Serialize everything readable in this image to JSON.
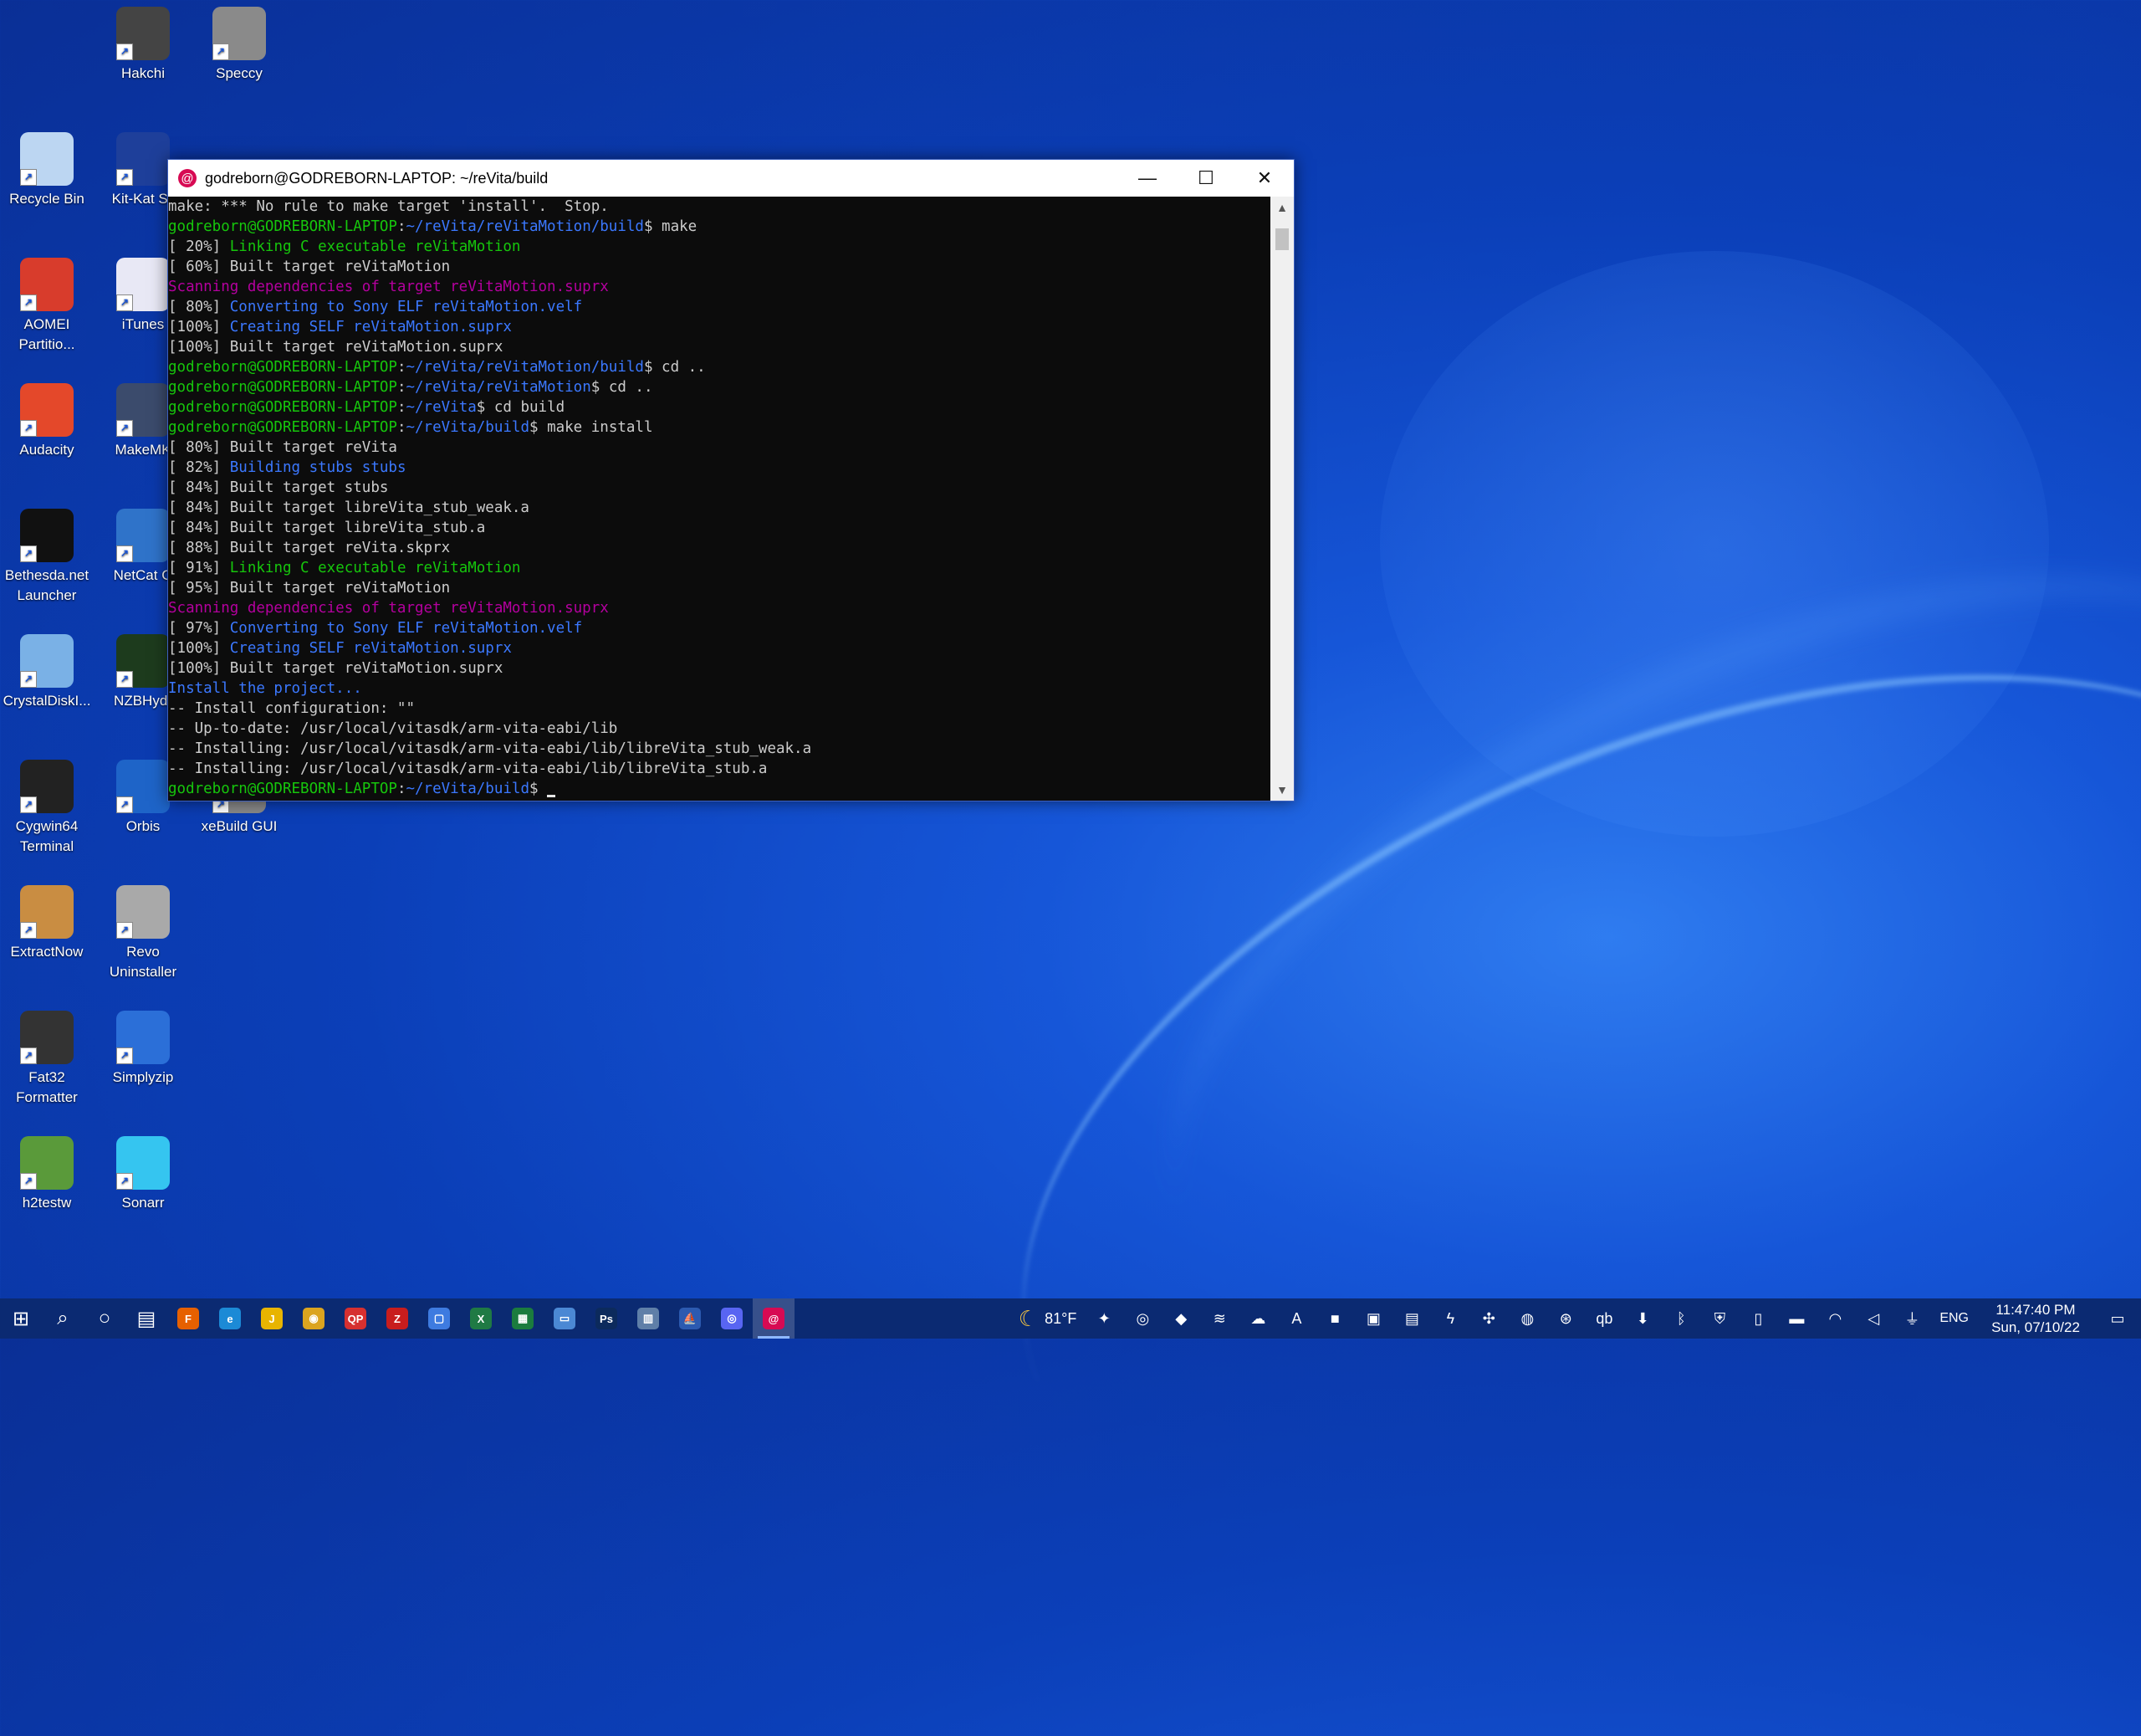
{
  "desktop": {
    "icons": [
      {
        "label": "Hakchi",
        "icon": "hakchi-icon",
        "color": "#444"
      },
      {
        "label": "Speccy",
        "icon": "speccy-icon",
        "color": "#8a8a8a"
      },
      {
        "label": "Recycle Bin",
        "icon": "recycle-bin-icon",
        "color": "#bcd6f2"
      },
      {
        "label": "Kit-Kat Sli",
        "icon": "kit-kat-slim-icon",
        "color": "#1e3f9a"
      },
      {
        "label": "AOMEI Partitio...",
        "icon": "aomei-icon",
        "color": "#d83c2c"
      },
      {
        "label": "iTunes",
        "icon": "itunes-icon",
        "color": "#e8e8f5"
      },
      {
        "label": "Audacity",
        "icon": "audacity-icon",
        "color": "#e4482a"
      },
      {
        "label": "MakeMK",
        "icon": "makemkv-icon",
        "color": "#3b4b6c"
      },
      {
        "label": "Bethesda.net Launcher",
        "icon": "bethesda-icon",
        "color": "#111"
      },
      {
        "label": "NetCat G",
        "icon": "netcat-icon",
        "color": "#2f73c9"
      },
      {
        "label": "CrystalDiskI...",
        "icon": "crystaldisk-icon",
        "color": "#7ab1e6"
      },
      {
        "label": "NZBHydr",
        "icon": "nzbhydra-icon",
        "color": "#1d3b1d"
      },
      {
        "label": "Cygwin64 Terminal",
        "icon": "cygwin-icon",
        "color": "#222"
      },
      {
        "label": "Orbis",
        "icon": "orbis-icon",
        "color": "#1e64c8"
      },
      {
        "label": "xeBuild GUI",
        "icon": "xebuild-icon",
        "color": "#888"
      },
      {
        "label": "ExtractNow",
        "icon": "extractnow-icon",
        "color": "#c98d42"
      },
      {
        "label": "Revo Uninstaller",
        "icon": "revo-icon",
        "color": "#a9a9a9"
      },
      {
        "label": "Fat32 Formatter",
        "icon": "fat32-icon",
        "color": "#333"
      },
      {
        "label": "Simplyzip",
        "icon": "simplyzip-icon",
        "color": "#2b6fd8"
      },
      {
        "label": "h2testw",
        "icon": "h2testw-icon",
        "color": "#5a9a3a"
      },
      {
        "label": "Sonarr",
        "icon": "sonarr-icon",
        "color": "#35c5f0"
      }
    ]
  },
  "terminal": {
    "title": "godreborn@GODREBORN-LAPTOP: ~/reVita/build",
    "minimize": "—",
    "maximize": "☐",
    "close": "✕",
    "lines": [
      [
        {
          "t": "make: *** No rule to make target 'install'.  Stop.",
          "c": ""
        }
      ],
      [
        {
          "t": "godreborn@GODREBORN-LAPTOP",
          "c": "c-green"
        },
        {
          "t": ":",
          "c": ""
        },
        {
          "t": "~/reVita/reVitaMotion/build",
          "c": "c-blue"
        },
        {
          "t": "$ make",
          "c": ""
        }
      ],
      [
        {
          "t": "[ 20%] ",
          "c": ""
        },
        {
          "t": "Linking C executable reVitaMotion",
          "c": "c-green"
        }
      ],
      [
        {
          "t": "[ 60%] Built target reVitaMotion",
          "c": ""
        }
      ],
      [
        {
          "t": "Scanning dependencies of target reVitaMotion.suprx",
          "c": "c-magenta"
        }
      ],
      [
        {
          "t": "[ 80%] ",
          "c": ""
        },
        {
          "t": "Converting to Sony ELF reVitaMotion.velf",
          "c": "c-blue"
        }
      ],
      [
        {
          "t": "[100%] ",
          "c": ""
        },
        {
          "t": "Creating SELF reVitaMotion.suprx",
          "c": "c-blue"
        }
      ],
      [
        {
          "t": "[100%] Built target reVitaMotion.suprx",
          "c": ""
        }
      ],
      [
        {
          "t": "godreborn@GODREBORN-LAPTOP",
          "c": "c-green"
        },
        {
          "t": ":",
          "c": ""
        },
        {
          "t": "~/reVita/reVitaMotion/build",
          "c": "c-blue"
        },
        {
          "t": "$ cd ..",
          "c": ""
        }
      ],
      [
        {
          "t": "godreborn@GODREBORN-LAPTOP",
          "c": "c-green"
        },
        {
          "t": ":",
          "c": ""
        },
        {
          "t": "~/reVita/reVitaMotion",
          "c": "c-blue"
        },
        {
          "t": "$ cd ..",
          "c": ""
        }
      ],
      [
        {
          "t": "godreborn@GODREBORN-LAPTOP",
          "c": "c-green"
        },
        {
          "t": ":",
          "c": ""
        },
        {
          "t": "~/reVita",
          "c": "c-blue"
        },
        {
          "t": "$ cd build",
          "c": ""
        }
      ],
      [
        {
          "t": "godreborn@GODREBORN-LAPTOP",
          "c": "c-green"
        },
        {
          "t": ":",
          "c": ""
        },
        {
          "t": "~/reVita/build",
          "c": "c-blue"
        },
        {
          "t": "$ make install",
          "c": ""
        }
      ],
      [
        {
          "t": "[ 80%] Built target reVita",
          "c": ""
        }
      ],
      [
        {
          "t": "[ 82%] ",
          "c": ""
        },
        {
          "t": "Building stubs stubs",
          "c": "c-blue"
        }
      ],
      [
        {
          "t": "[ 84%] Built target stubs",
          "c": ""
        }
      ],
      [
        {
          "t": "[ 84%] Built target libreVita_stub_weak.a",
          "c": ""
        }
      ],
      [
        {
          "t": "[ 84%] Built target libreVita_stub.a",
          "c": ""
        }
      ],
      [
        {
          "t": "[ 88%] Built target reVita.skprx",
          "c": ""
        }
      ],
      [
        {
          "t": "[ 91%] ",
          "c": ""
        },
        {
          "t": "Linking C executable reVitaMotion",
          "c": "c-green"
        }
      ],
      [
        {
          "t": "[ 95%] Built target reVitaMotion",
          "c": ""
        }
      ],
      [
        {
          "t": "Scanning dependencies of target reVitaMotion.suprx",
          "c": "c-magenta"
        }
      ],
      [
        {
          "t": "[ 97%] ",
          "c": ""
        },
        {
          "t": "Converting to Sony ELF reVitaMotion.velf",
          "c": "c-blue"
        }
      ],
      [
        {
          "t": "[100%] ",
          "c": ""
        },
        {
          "t": "Creating SELF reVitaMotion.suprx",
          "c": "c-blue"
        }
      ],
      [
        {
          "t": "[100%] Built target reVitaMotion.suprx",
          "c": ""
        }
      ],
      [
        {
          "t": "Install the project...",
          "c": "c-blue"
        }
      ],
      [
        {
          "t": "-- Install configuration: \"\"",
          "c": ""
        }
      ],
      [
        {
          "t": "-- Up-to-date: /usr/local/vitasdk/arm-vita-eabi/lib",
          "c": ""
        }
      ],
      [
        {
          "t": "-- Installing: /usr/local/vitasdk/arm-vita-eabi/lib/libreVita_stub_weak.a",
          "c": ""
        }
      ],
      [
        {
          "t": "-- Installing: /usr/local/vitasdk/arm-vita-eabi/lib/libreVita_stub.a",
          "c": ""
        }
      ],
      [
        {
          "t": "godreborn@GODREBORN-LAPTOP",
          "c": "c-green"
        },
        {
          "t": ":",
          "c": ""
        },
        {
          "t": "~/reVita/build",
          "c": "c-blue"
        },
        {
          "t": "$ ",
          "c": ""
        }
      ]
    ]
  },
  "taskbar": {
    "apps": [
      {
        "icon": "start-icon",
        "glyph": "⊞",
        "color": "transparent"
      },
      {
        "icon": "search-icon",
        "glyph": "⌕",
        "color": "transparent"
      },
      {
        "icon": "cortana-icon",
        "glyph": "○",
        "color": "transparent"
      },
      {
        "icon": "task-view-icon",
        "glyph": "▤",
        "color": "transparent"
      },
      {
        "icon": "firefox-icon",
        "glyph": "F",
        "color": "#e66000"
      },
      {
        "icon": "edge-icon",
        "glyph": "e",
        "color": "#1c8ad6"
      },
      {
        "icon": "jdownloader-icon",
        "glyph": "J",
        "color": "#e8b400"
      },
      {
        "icon": "chrome-icon",
        "glyph": "◉",
        "color": "#dba41f"
      },
      {
        "icon": "qbittorrent-icon",
        "glyph": "QP",
        "color": "#d63030"
      },
      {
        "icon": "filezilla-icon",
        "glyph": "Z",
        "color": "#c81d1d"
      },
      {
        "icon": "window-app-icon",
        "glyph": "▢",
        "color": "#3e7be0"
      },
      {
        "icon": "excel-icon",
        "glyph": "X",
        "color": "#1f7a44"
      },
      {
        "icon": "spreadsheet-icon",
        "glyph": "▦",
        "color": "#1b7c3e"
      },
      {
        "icon": "media-icon",
        "glyph": "▭",
        "color": "#4b88d4"
      },
      {
        "icon": "photoshop-icon",
        "glyph": "Ps",
        "color": "#0c2a5c"
      },
      {
        "icon": "calculator-icon",
        "glyph": "▥",
        "color": "#5f7fa8"
      },
      {
        "icon": "ship-icon",
        "glyph": "⛵",
        "color": "#2c5ab0"
      },
      {
        "icon": "discord-icon",
        "glyph": "◎",
        "color": "#5865f2"
      },
      {
        "icon": "debian-terminal-icon",
        "glyph": "@",
        "color": "#d70a53"
      }
    ],
    "weather_icon": "moon-icon",
    "weather_text": "81°F",
    "tray_icons": [
      {
        "icon": "leaf-tray-icon",
        "glyph": "✦"
      },
      {
        "icon": "discord-tray-icon",
        "glyph": "◎"
      },
      {
        "icon": "nvidia-tray-icon",
        "glyph": "◆"
      },
      {
        "icon": "docker-tray-icon",
        "glyph": "≋"
      },
      {
        "icon": "onedrive-tray-icon",
        "glyph": "☁"
      },
      {
        "icon": "font-tray-icon",
        "glyph": "A"
      },
      {
        "icon": "red-app-tray-icon",
        "glyph": "■"
      },
      {
        "icon": "drive-tray-icon",
        "glyph": "▣"
      },
      {
        "icon": "device-tray-icon",
        "glyph": "▤"
      },
      {
        "icon": "lightning-tray-icon",
        "glyph": "ϟ"
      },
      {
        "icon": "sync-tray-icon",
        "glyph": "✣"
      },
      {
        "icon": "steam-tray-icon",
        "glyph": "◍"
      },
      {
        "icon": "lifebuoy-tray-icon",
        "glyph": "⊛"
      },
      {
        "icon": "qb-tray-icon",
        "glyph": "qb"
      },
      {
        "icon": "download-tray-icon",
        "glyph": "⬇"
      },
      {
        "icon": "bluetooth-tray-icon",
        "glyph": "ᛒ"
      },
      {
        "icon": "defender-tray-icon",
        "glyph": "⛨"
      },
      {
        "icon": "phone-tray-icon",
        "glyph": "▯"
      },
      {
        "icon": "battery-tray-icon",
        "glyph": "▬"
      },
      {
        "icon": "wifi-tray-icon",
        "glyph": "◠"
      },
      {
        "icon": "volume-tray-icon",
        "glyph": "◁"
      },
      {
        "icon": "usb-tray-icon",
        "glyph": "⏚"
      }
    ],
    "language": "ENG",
    "time": "11:47:40 PM",
    "date": "Sun, 07/10/22",
    "notification_icon": "notification-icon"
  }
}
